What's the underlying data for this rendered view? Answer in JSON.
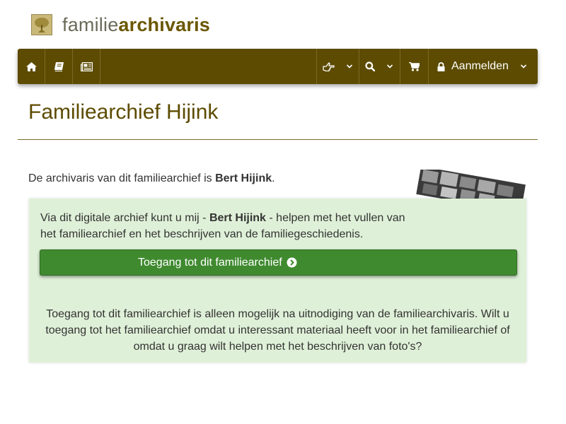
{
  "brand": {
    "prefix": "familie",
    "suffix": "archivaris",
    "logo_icon": "tree-icon"
  },
  "navbar": {
    "items": [
      {
        "name": "home",
        "icon": "home-icon"
      },
      {
        "name": "book",
        "icon": "book-icon"
      },
      {
        "name": "news",
        "icon": "newspaper-icon"
      },
      {
        "name": "hand",
        "icon": "hand-point-icon",
        "dropdown": true
      },
      {
        "name": "search",
        "icon": "search-icon",
        "dropdown": true
      },
      {
        "name": "cart",
        "icon": "cart-icon"
      }
    ],
    "login_label": "Aanmelden"
  },
  "page": {
    "title": "Familiearchief Hijink",
    "intro_prefix": "De archivaris van dit familiearchief is ",
    "intro_name": "Bert Hijink",
    "intro_suffix": "."
  },
  "panel": {
    "text_prefix": "Via dit digitale archief kunt u mij - ",
    "text_name": "Bert Hijink",
    "text_suffix": " - helpen met het vullen van het familiearchief en het beschrijven van de familiegeschiedenis.",
    "button_label": "Toegang tot dit familiearchief",
    "note": "Toegang tot dit familiearchief is alleen mogelijk na uitnodiging van de familiearchivaris. Wilt u toegang tot het familiearchief omdat u interessant materiaal heeft voor in het familiearchief of omdat u graag wilt helpen met het beschrijven van foto's?"
  },
  "colors": {
    "navbar": "#5c4b00",
    "title": "#5c4b00",
    "panel": "#dff0d8",
    "button": "#3f8a2f"
  }
}
